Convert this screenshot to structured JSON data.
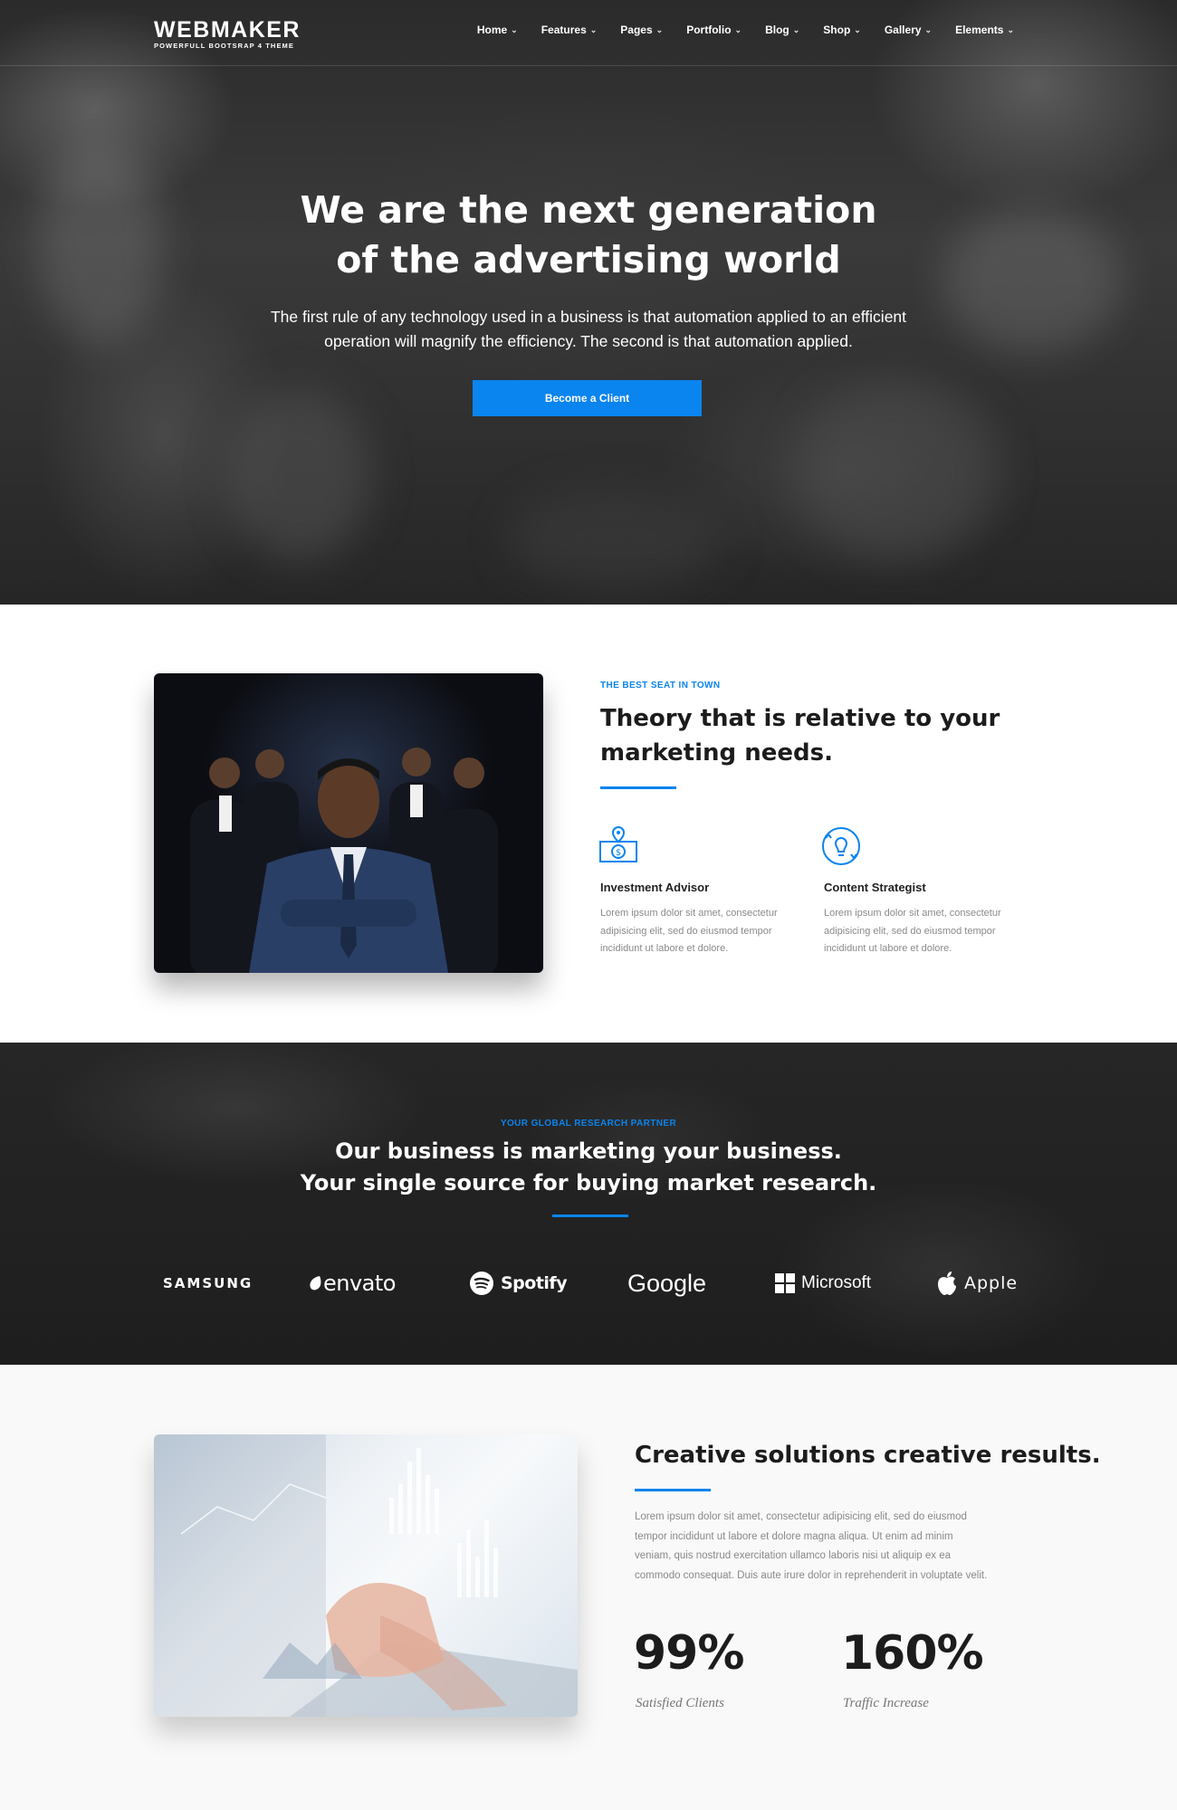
{
  "header": {
    "logo_main": "WEBMAKER",
    "logo_sub": "POWERFULL BOOTSRAP 4 THEME",
    "nav": [
      "Home",
      "Features",
      "Pages",
      "Portfolio",
      "Blog",
      "Shop",
      "Gallery",
      "Elements"
    ]
  },
  "hero": {
    "title_line1": "We are the next generation",
    "title_line2": "of the advertising world",
    "subtitle_line1": "The first rule of any technology used in a business is that automation applied to an efficient",
    "subtitle_line2": "operation will magnify the efficiency. The second is that automation applied.",
    "cta_label": "Become a Client"
  },
  "about": {
    "eyebrow": "THE BEST SEAT IN TOWN",
    "title_line1": "Theory that is relative to your",
    "title_line2": "marketing needs.",
    "features": [
      {
        "icon": "money-location-icon",
        "title": "Investment Advisor",
        "text_lines": [
          "Lorem ipsum dolor sit amet, consectetur",
          "adipisicing elit, sed do eiusmod tempor",
          "incididunt ut labore et dolore."
        ]
      },
      {
        "icon": "lightbulb-icon",
        "title": "Content Strategist",
        "text_lines": [
          "Lorem ipsum dolor sit amet, consectetur",
          "adipisicing elit, sed do eiusmod tempor",
          "incididunt ut labore et dolore."
        ]
      }
    ]
  },
  "partners": {
    "eyebrow": "YOUR GLOBAL RESEARCH PARTNER",
    "title_line1": "Our business is marketing your business.",
    "title_line2": "Your single source for buying market research.",
    "brands": [
      "SAMSUNG",
      "envato",
      "Spotify",
      "Google",
      "Microsoft",
      "Apple"
    ]
  },
  "results": {
    "title": "Creative solutions creative results.",
    "text_lines": [
      "Lorem ipsum dolor sit amet, consectetur adipisicing elit, sed do eiusmod",
      "tempor incididunt ut labore et dolore magna aliqua. Ut enim ad minim",
      "veniam, quis nostrud exercitation ullamco laboris nisi ut aliquip ex ea",
      "commodo consequat. Duis aute irure dolor in reprehenderit in voluptate velit."
    ],
    "stats": [
      {
        "value": "99%",
        "label": "Satisfied Clients"
      },
      {
        "value": "160%",
        "label": "Traffic Increase"
      }
    ]
  },
  "colors": {
    "accent": "#0a84ee",
    "dark_bg": "#222222",
    "light_bg": "#f9f9f9"
  }
}
